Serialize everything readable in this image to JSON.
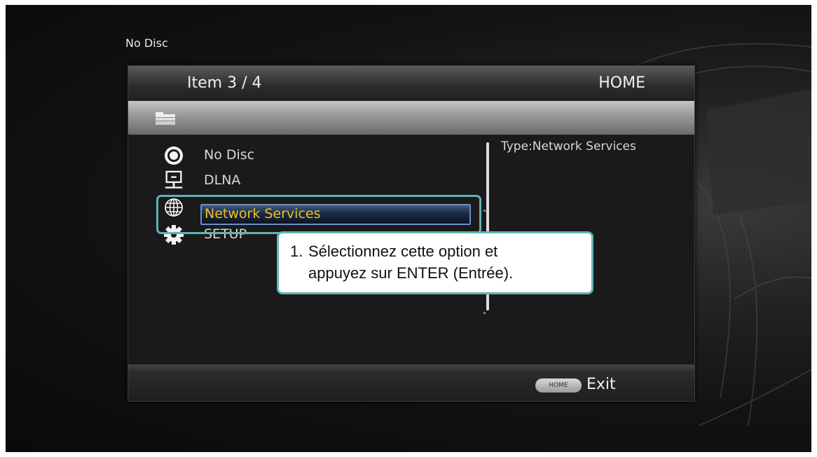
{
  "status": {
    "disc_state": "No Disc"
  },
  "header": {
    "item_counter": "Item 3 / 4",
    "title": "HOME"
  },
  "menu": {
    "items": [
      {
        "label": "No Disc",
        "icon": "disc-icon"
      },
      {
        "label": "DLNA",
        "icon": "dlna-network-icon"
      },
      {
        "label": "Network Services",
        "icon": "globe-icon",
        "selected": true
      },
      {
        "label": "SETUP",
        "icon": "gear-icon"
      }
    ]
  },
  "info": {
    "type_text": "Type:Network Services"
  },
  "callout": {
    "number": "1.",
    "line1": "Sélectionnez cette option et",
    "line2": "appuyez sur ENTER (Entrée)."
  },
  "footer": {
    "home_key_label": "HOME",
    "exit_label": "Exit"
  },
  "colors": {
    "highlight_outline": "#5fb3b6",
    "selected_text": "#f0c020",
    "selected_border": "#6d8fc2"
  }
}
